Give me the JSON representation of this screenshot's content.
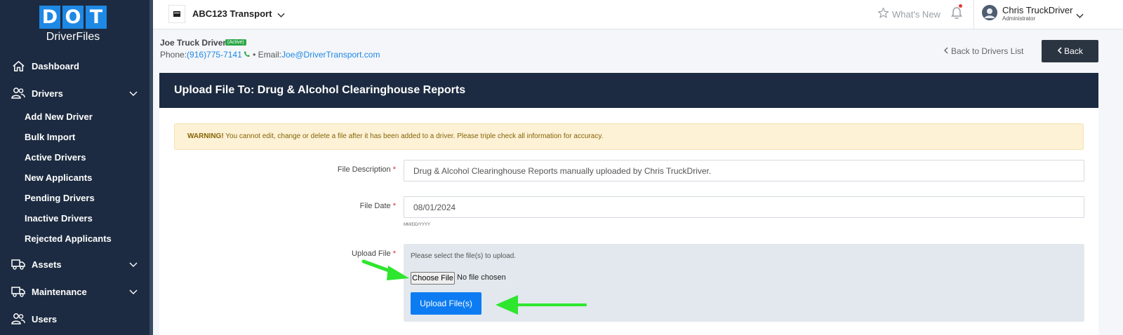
{
  "logo": {
    "letters": [
      "D",
      "O",
      "T"
    ],
    "subtitle": "DriverFiles"
  },
  "sidebar": {
    "items": [
      {
        "label": "Dashboard",
        "icon": "home-icon"
      },
      {
        "label": "Drivers",
        "icon": "users-icon"
      },
      {
        "label": "Assets",
        "icon": "truck-icon"
      },
      {
        "label": "Maintenance",
        "icon": "truck-icon"
      },
      {
        "label": "Users",
        "icon": "users-icon"
      }
    ],
    "drivers_sub": [
      "Add New Driver",
      "Bulk Import",
      "Active Drivers",
      "New Applicants",
      "Pending Drivers",
      "Inactive Drivers",
      "Rejected Applicants"
    ]
  },
  "topbar": {
    "company": "ABC123 Transport",
    "whats_new": "What's New",
    "user_name": "Chris TruckDriver",
    "user_role": "Administrator"
  },
  "driver": {
    "name": "Joe Truck Driver",
    "status": "(Active)",
    "phone_label": "Phone:",
    "phone": "(916)775-7141",
    "email_label": "Email:",
    "email": "Joe@DriverTransport.com",
    "back_link": "Back to Drivers List",
    "back_button": "Back"
  },
  "card": {
    "title": "Upload File To: Drug & Alcohol Clearinghouse Reports",
    "warning_strong": "WARNING!",
    "warning_text": " You cannot edit, change or delete a file after it has been added to a driver. Please triple check all information for accuracy.",
    "file_description_label": "File Description",
    "file_description_value": "Drug & Alcohol Clearinghouse Reports manually uploaded by Chris TruckDriver.",
    "file_date_label": "File Date",
    "file_date_value": "08/01/2024",
    "file_date_hint": "MM/DD/YYYY",
    "upload_label": "Upload File",
    "upload_prompt": "Please select the file(s) to upload.",
    "choose_button": "Choose File",
    "no_file": "No file chosen",
    "upload_button": "Upload File(s)",
    "required_mark": "*"
  },
  "colors": {
    "sidebar_bg": "#1c2b41",
    "accent": "#1e88e5",
    "upload_button": "#0d7cf2",
    "active_badge": "#28a745",
    "arrow": "#2ee62e"
  }
}
